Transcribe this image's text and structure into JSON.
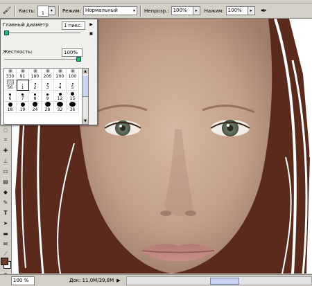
{
  "options_bar": {
    "brush_label": "Кисть:",
    "brush_size": "1",
    "mode_label": "Режим:",
    "mode_value": "Нормальный",
    "opacity_label": "Непрозр.:",
    "opacity_value": "100%",
    "flow_label": "Нажим:",
    "flow_value": "100%"
  },
  "brush_panel": {
    "master_diameter_label": "Главный диаметр",
    "master_diameter_value": "1 пикс.",
    "hardness_label": "Жесткость:",
    "hardness_value": "100%",
    "diameter_fraction": 0.0,
    "hardness_fraction": 1.0,
    "presets": [
      {
        "size": "330",
        "kind": "soft"
      },
      {
        "size": "91",
        "kind": "soft"
      },
      {
        "size": "180",
        "kind": "soft"
      },
      {
        "size": "200",
        "kind": "soft"
      },
      {
        "size": "200",
        "kind": "soft"
      },
      {
        "size": "100",
        "kind": "soft"
      },
      {
        "size": "56",
        "kind": "shape"
      },
      {
        "size": "1",
        "kind": "hard"
      },
      {
        "size": "2",
        "kind": "hard"
      },
      {
        "size": "3",
        "kind": "hard"
      },
      {
        "size": "4",
        "kind": "hard"
      },
      {
        "size": "5",
        "kind": "hard"
      },
      {
        "size": "6",
        "kind": "hard"
      },
      {
        "size": "7",
        "kind": "hard"
      },
      {
        "size": "8",
        "kind": "hard"
      },
      {
        "size": "9",
        "kind": "hard"
      },
      {
        "size": "12",
        "kind": "hard"
      },
      {
        "size": "15",
        "kind": "hard"
      },
      {
        "size": "18",
        "kind": "hard"
      },
      {
        "size": "19",
        "kind": "hard"
      },
      {
        "size": "24",
        "kind": "hard"
      },
      {
        "size": "28",
        "kind": "hard"
      },
      {
        "size": "32",
        "kind": "hard"
      },
      {
        "size": "36",
        "kind": "hard"
      }
    ]
  },
  "status_bar": {
    "zoom": "100 %",
    "doc_info": "Док: 11,0M/39,8M"
  },
  "colors": {
    "foreground": "#6e3b2b",
    "background": "#ffffff",
    "hair": "#5a2a1c",
    "skin": "#c9a892"
  },
  "icons": {
    "brush_tool": "brush-icon",
    "airbrush": "airbrush-icon",
    "panel_menu": "triangle-right-icon"
  }
}
